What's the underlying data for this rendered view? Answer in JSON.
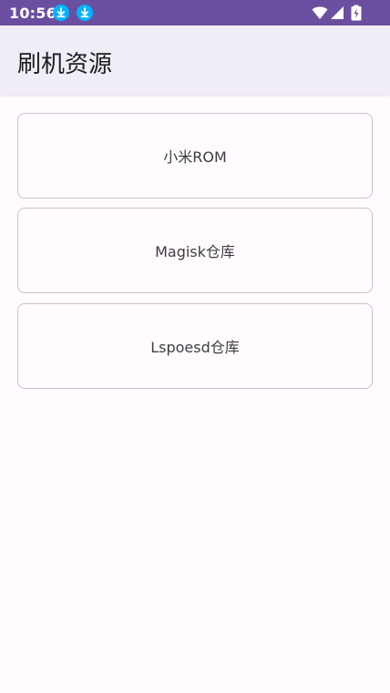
{
  "status_bar": {
    "time": "10:56",
    "bg_color": "#6a4fa0",
    "notification_icons": [
      "download-icon",
      "download-icon"
    ],
    "system_icons": [
      "wifi-icon",
      "signal-icon",
      "battery-charging-icon"
    ]
  },
  "app_bar": {
    "title": "刷机资源"
  },
  "cards": [
    {
      "label": "小米ROM"
    },
    {
      "label": "Magisk仓库"
    },
    {
      "label": "Lspoesd仓库"
    }
  ]
}
